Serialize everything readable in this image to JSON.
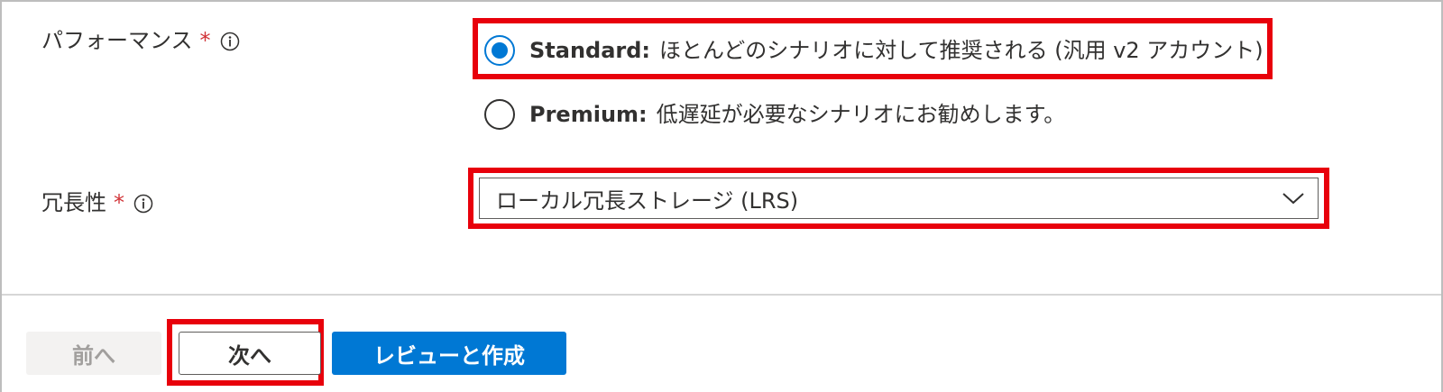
{
  "performance": {
    "label": "パフォーマンス",
    "required_mark": "*",
    "options": [
      {
        "name": "Standard:",
        "description": "ほとんどのシナリオに対して推奨される (汎用 v2 アカウント)",
        "checked": true
      },
      {
        "name": "Premium:",
        "description": "低遅延が必要なシナリオにお勧めします。",
        "checked": false
      }
    ]
  },
  "redundancy": {
    "label": "冗長性",
    "required_mark": "*",
    "selected": "ローカル冗長ストレージ (LRS)"
  },
  "footer": {
    "prev_label": "前へ",
    "next_label": "次へ",
    "review_label": "レビューと作成"
  },
  "colors": {
    "accent": "#0078d4",
    "highlight": "#e8000b",
    "required": "#d13438"
  },
  "icons": {
    "info": "info-icon",
    "chevron": "chevron-down-icon"
  }
}
